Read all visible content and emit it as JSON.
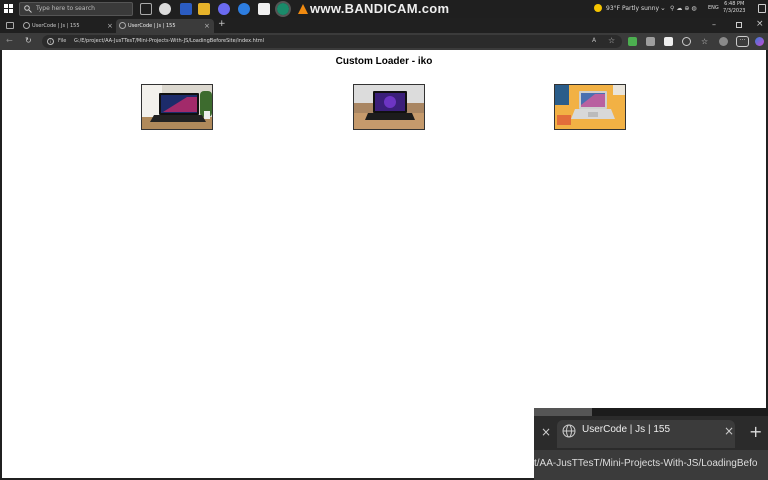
{
  "taskbar": {
    "search_placeholder": "Type here to search",
    "watermark": "www.BANDICAM.com",
    "weather": "93°F  Partly sunny",
    "lang": "ENG",
    "time": "6:48 PM",
    "date": "7/3/2023"
  },
  "browser": {
    "tabs": [
      {
        "label": "UserCode | Js | 155",
        "active": false
      },
      {
        "label": "UserCode | Js | 155",
        "active": true
      }
    ],
    "address": {
      "scheme_label": "File",
      "url": "G:/E/project/AA-JusTTesT/Mini-Projects-With-JS/LoadingBeforeSite/index.html"
    }
  },
  "page": {
    "title": "Custom Loader - iko",
    "images": [
      {
        "name": "laptop-image-1",
        "scene": "laptop on wooden desk with plant"
      },
      {
        "name": "laptop-image-2",
        "scene": "laptop on wooden table"
      },
      {
        "name": "laptop-image-3",
        "scene": "laptop on yellow surface"
      }
    ]
  },
  "zoom_overlay": {
    "tab_label": "UserCode | Js | 155",
    "url_fragment": "t/AA-JusTTesT/Mini-Projects-With-JS/LoadingBefo"
  },
  "colors": {
    "taskbar_bg": "#1f1f1f",
    "toolbar_bg": "#3b3b3b",
    "page_bg": "#ffffff"
  }
}
